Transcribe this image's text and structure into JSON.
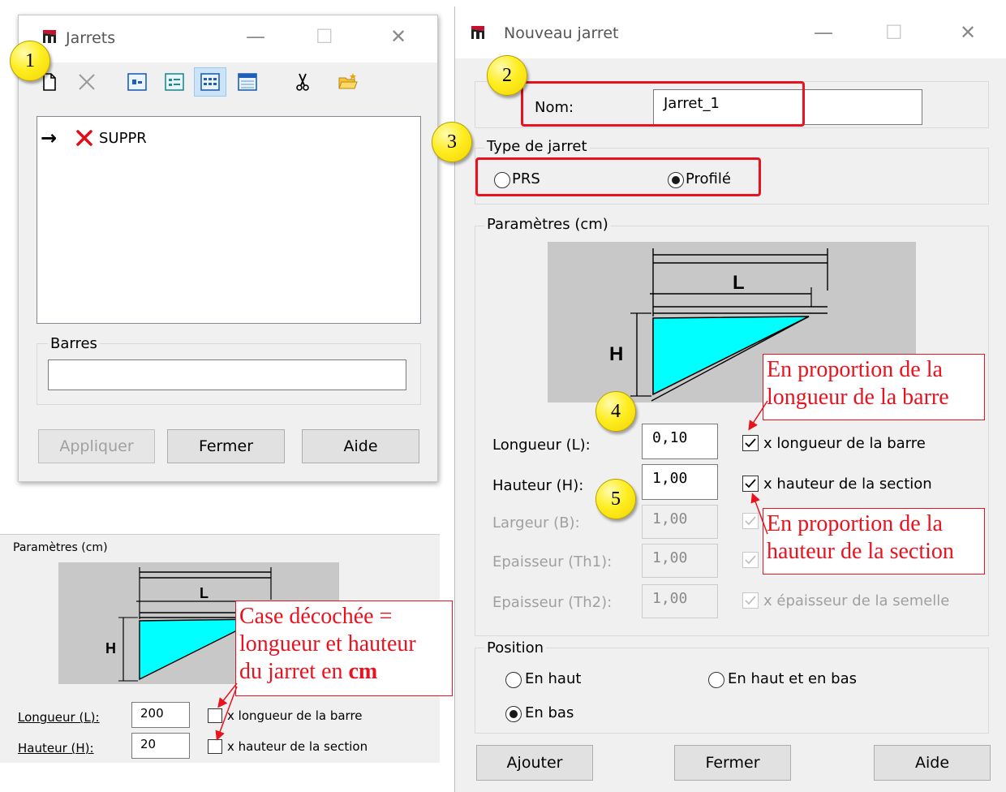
{
  "jarrets_window": {
    "title": "Jarrets",
    "window_buttons": {
      "minimize": "—",
      "maximize": "☐",
      "close": "✕"
    },
    "list_items": [
      {
        "arrow": "→",
        "label": "SUPPR"
      }
    ],
    "barres_group": {
      "label": "Barres",
      "value": ""
    },
    "buttons": {
      "apply": "Appliquer",
      "close": "Fermer",
      "help": "Aide"
    }
  },
  "nouveau_window": {
    "title": "Nouveau jarret",
    "window_buttons": {
      "minimize": "—",
      "maximize": "☐",
      "close": "✕"
    },
    "nom": {
      "label": "Nom:",
      "value": "Jarret_1"
    },
    "type_group": {
      "label": "Type de jarret",
      "options": [
        "PRS",
        "Profilé"
      ],
      "selected": "Profilé"
    },
    "params_group": {
      "label": "Paramètres (cm)",
      "diagram": {
        "L": "L",
        "H": "H"
      },
      "rows": [
        {
          "label": "Longueur (L):",
          "value": "0,10",
          "checkbox_label": "x longueur de la barre",
          "checked": true,
          "enabled": true
        },
        {
          "label": "Hauteur (H):",
          "value": "1,00",
          "checkbox_label": "x hauteur de la section",
          "checked": true,
          "enabled": true
        },
        {
          "label": "Largeur (B):",
          "value": "1,00",
          "checkbox_label": "",
          "checked": true,
          "enabled": false
        },
        {
          "label": "Epaisseur (Th1):",
          "value": "1,00",
          "checkbox_label": "",
          "checked": true,
          "enabled": false
        },
        {
          "label": "Epaisseur (Th2):",
          "value": "1,00",
          "checkbox_label": "x épaisseur de la semelle",
          "checked": true,
          "enabled": false
        }
      ]
    },
    "position_group": {
      "label": "Position",
      "options": [
        "En haut",
        "En haut et en bas",
        "En bas"
      ],
      "selected": "En bas"
    },
    "buttons": {
      "add": "Ajouter",
      "close": "Fermer",
      "help": "Aide"
    }
  },
  "inset_panel": {
    "label": "Paramètres (cm)",
    "diagram": {
      "L": "L",
      "H": "H"
    },
    "rows": [
      {
        "label": "Longueur (L):",
        "value": "200",
        "checkbox_label": "x longueur de la barre",
        "checked": false
      },
      {
        "label": "Hauteur (H):",
        "value": "20",
        "checkbox_label": "x hauteur de la section",
        "checked": false
      }
    ]
  },
  "annotations": {
    "numbers": [
      "1",
      "2",
      "3",
      "4",
      "5"
    ],
    "callouts": {
      "longueur": "En proportion de la longueur de la barre",
      "hauteur": "En proportion de la hauteur de la section",
      "case_decochee_1": "Case décochée =",
      "case_decochee_2": "longueur et hauteur",
      "case_decochee_3": "du jarret en",
      "case_decochee_bold": "cm"
    }
  },
  "colors": {
    "highlight_red": "#e8131f",
    "badge_yellow": "#ffee22",
    "haunch_cyan": "#00ffff",
    "diagram_bg": "#c8c8c8"
  }
}
